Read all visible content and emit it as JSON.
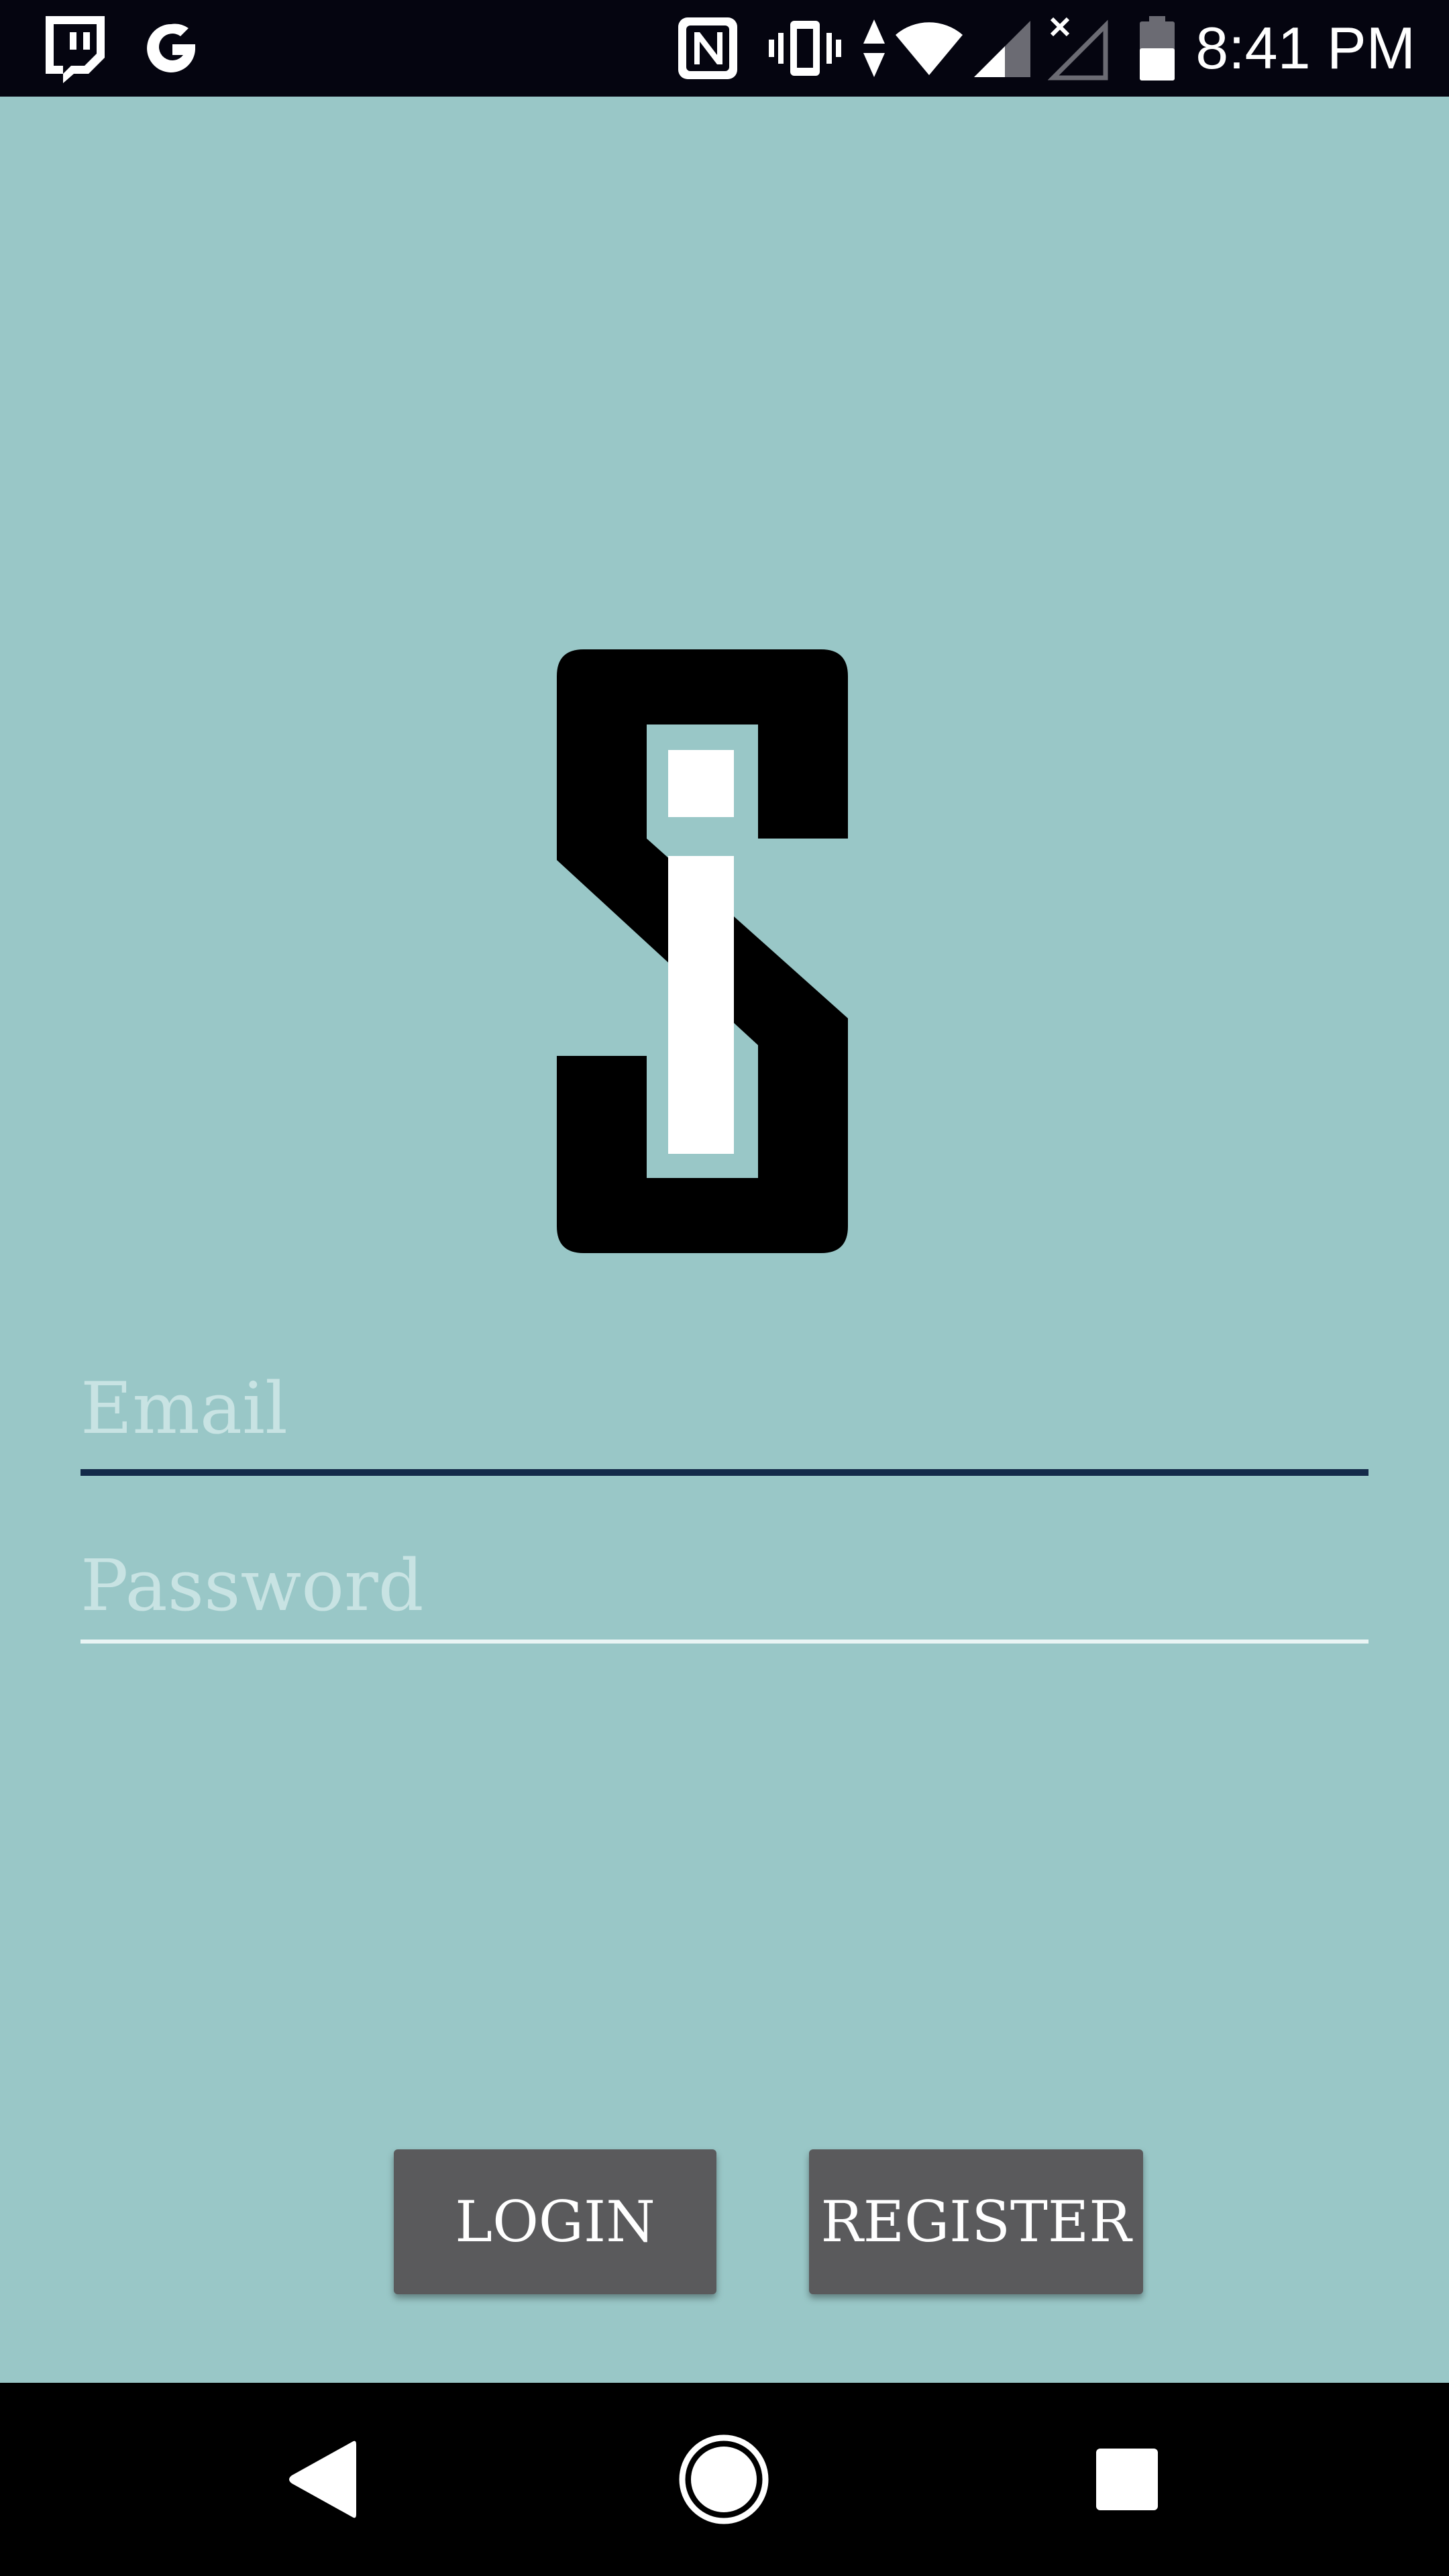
{
  "status_bar": {
    "time": "8:41 PM",
    "icons": [
      "twitch-notification-icon",
      "google-notification-icon",
      "nfc-icon",
      "vibrate-icon",
      "data-activity-icon",
      "wifi-icon",
      "cell-signal-icon",
      "no-sim-icon",
      "battery-icon"
    ]
  },
  "logo": {
    "name": "si-logo"
  },
  "login_form": {
    "email_placeholder": "Email",
    "password_placeholder": "Password",
    "email_value": "",
    "password_value": "",
    "login_label": "LOGIN",
    "register_label": "REGISTER"
  },
  "nav_bar": {
    "icons": [
      "back-icon",
      "home-icon",
      "recents-icon"
    ]
  },
  "colors": {
    "background": "#99c7c7",
    "status_bar": "#050510",
    "button": "#5a5a5c",
    "email_underline_focused": "#142b4a",
    "password_underline": "#e9f4f4",
    "placeholder": "#c8e3e3",
    "nav_bar": "#000000"
  }
}
